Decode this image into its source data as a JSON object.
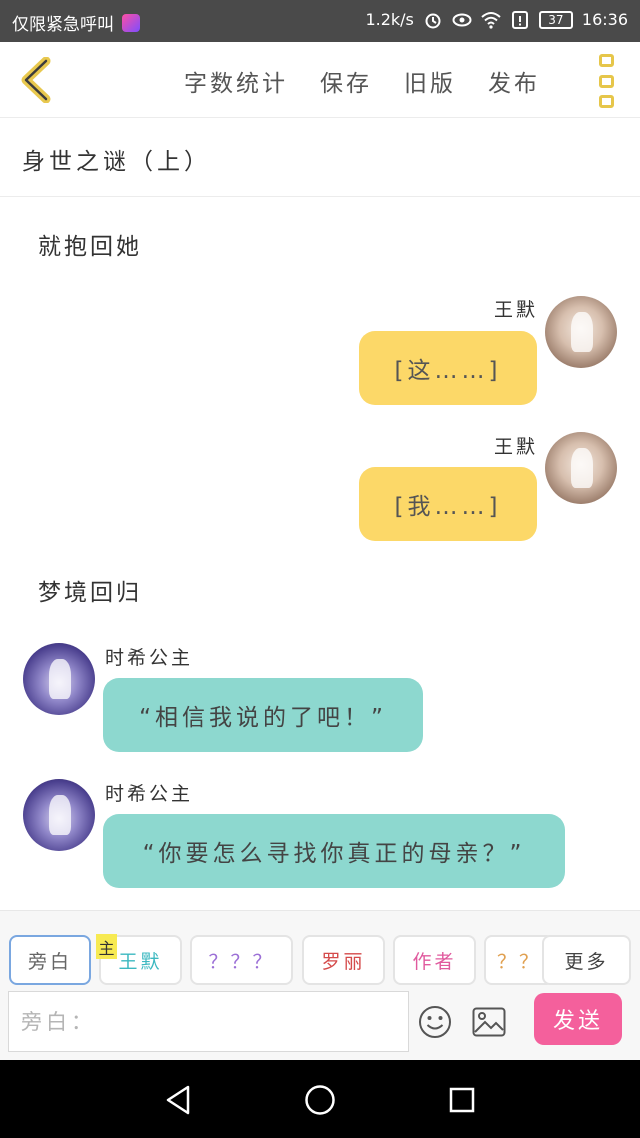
{
  "status_bar": {
    "carrier": "仅限紧急呼叫",
    "speed": "1.2k/s",
    "battery": "37",
    "time": "16:36"
  },
  "toolbar": {
    "actions": [
      "字数统计",
      "保存",
      "旧版",
      "发布"
    ]
  },
  "chapter": {
    "title": "身世之谜（上）"
  },
  "story": {
    "narration_1": "就抱回她",
    "messages_right": [
      {
        "speaker": "王默",
        "text": "[这……]"
      },
      {
        "speaker": "王默",
        "text": "[我……]"
      }
    ],
    "narration_2": "梦境回归",
    "messages_left": [
      {
        "speaker": "时希公主",
        "text": "“相信我说的了吧！”"
      },
      {
        "speaker": "时希公主",
        "text": "“你要怎么寻找你真正的母亲？”"
      }
    ]
  },
  "composer": {
    "main_tag": "主",
    "chips": [
      {
        "label": "旁白",
        "color": "#666666"
      },
      {
        "label": "王默",
        "color": "#3cb8c0"
      },
      {
        "label": "？？？",
        "color": "#9b6fd6"
      },
      {
        "label": "罗丽",
        "color": "#d44a4a"
      },
      {
        "label": "作者",
        "color": "#e05a9e"
      },
      {
        "label": "？？",
        "color": "#e0a050"
      },
      {
        "label": "更多",
        "color": "#444444"
      }
    ],
    "input_placeholder": "旁白：",
    "send_label": "发送"
  },
  "colors": {
    "accent_yellow": "#fcd868",
    "bubble_teal": "#8dd8cf",
    "send_pink": "#f4609c"
  }
}
